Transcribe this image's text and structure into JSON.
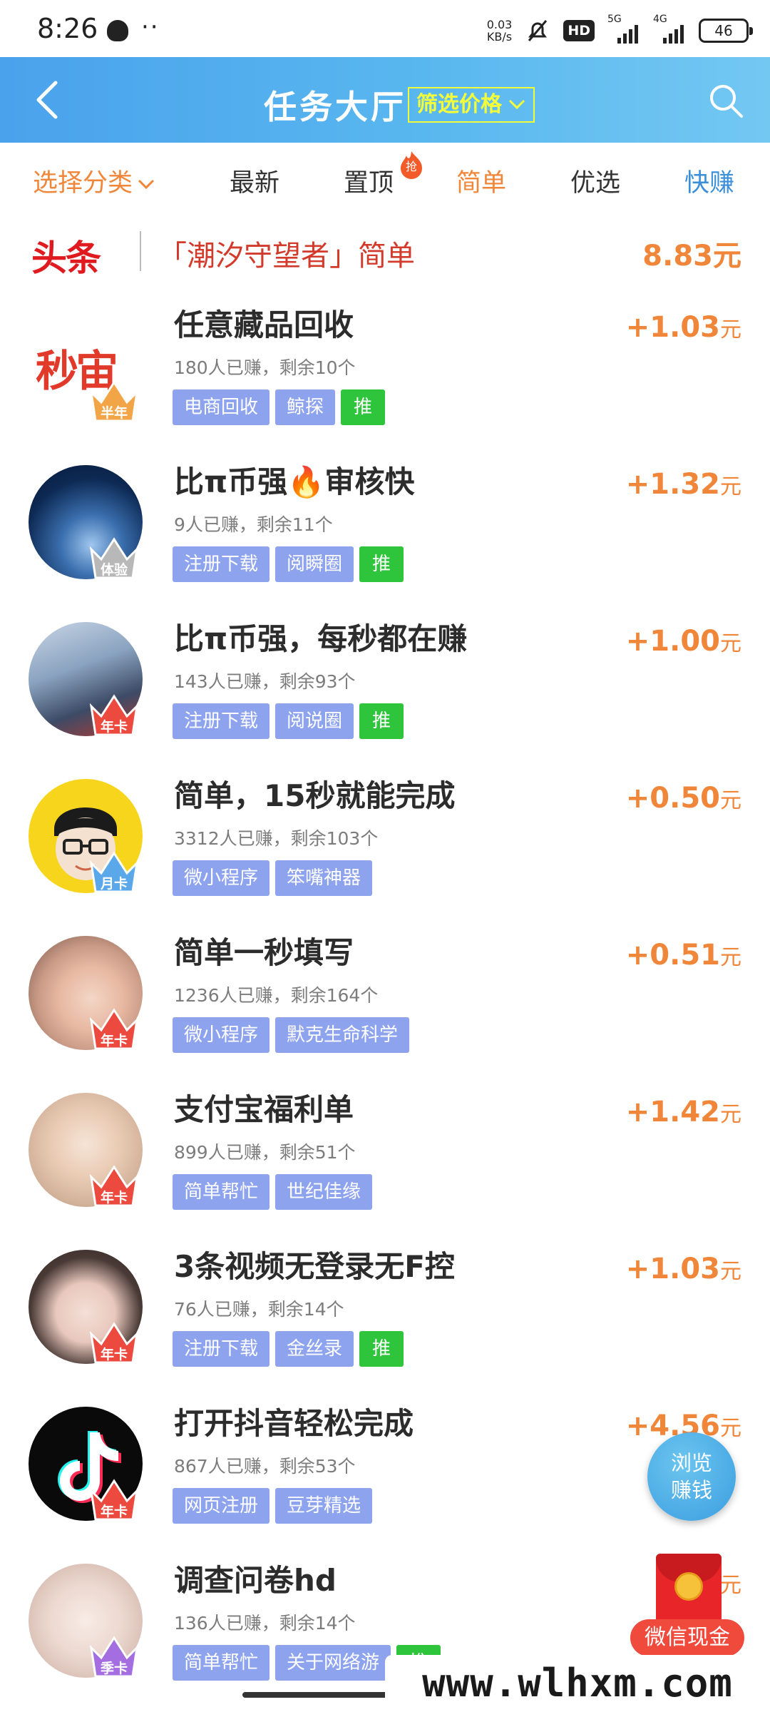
{
  "status_bar": {
    "time": "8:26",
    "dots": "··",
    "net_speed_value": "0.03",
    "net_speed_unit": "KB/s",
    "hd_label": "HD",
    "signal_1_label": "5G",
    "signal_2_label": "4G",
    "battery": "46"
  },
  "header": {
    "title": "任务大厅",
    "filter_label": "筛选价格"
  },
  "tabs": {
    "category_label": "选择分类",
    "items": [
      "最新",
      "置顶",
      "简单",
      "优选",
      "快赚"
    ],
    "hot_badge": "抢"
  },
  "headline": {
    "logo": "头条",
    "text": "「潮汐守望者」简单",
    "amount": "8.83元"
  },
  "tasks": [
    {
      "title": "任意藏品回收",
      "meta": "180人已赚，剩余10个",
      "reward": "+1.03",
      "unit": "元",
      "badge": "半年",
      "avatar_text": "秒宙",
      "tags": [
        "电商回收",
        "鲸探",
        "推"
      ]
    },
    {
      "title": "比π币强🔥审核快",
      "meta": "9人已赚，剩余11个",
      "reward": "+1.32",
      "unit": "元",
      "badge": "体验",
      "tags": [
        "注册下载",
        "阅瞬圈",
        "推"
      ]
    },
    {
      "title": "比π币强，每秒都在赚",
      "meta": "143人已赚，剩余93个",
      "reward": "+1.00",
      "unit": "元",
      "badge": "年卡",
      "tags": [
        "注册下载",
        "阅说圈",
        "推"
      ]
    },
    {
      "title": "简单，15秒就能完成",
      "meta": "3312人已赚，剩余103个",
      "reward": "+0.50",
      "unit": "元",
      "badge": "月卡",
      "tags": [
        "微小程序",
        "笨嘴神器"
      ]
    },
    {
      "title": "简单一秒填写",
      "meta": "1236人已赚，剩余164个",
      "reward": "+0.51",
      "unit": "元",
      "badge": "年卡",
      "tags": [
        "微小程序",
        "默克生命科学"
      ]
    },
    {
      "title": "支付宝福利单",
      "meta": "899人已赚，剩余51个",
      "reward": "+1.42",
      "unit": "元",
      "badge": "年卡",
      "tags": [
        "简单帮忙",
        "世纪佳缘"
      ]
    },
    {
      "title": "3条视频无登录无F控",
      "meta": "76人已赚，剩余14个",
      "reward": "+1.03",
      "unit": "元",
      "badge": "年卡",
      "tags": [
        "注册下载",
        "金丝录",
        "推"
      ]
    },
    {
      "title": "打开抖音轻松完成",
      "meta": "867人已赚，剩余53个",
      "reward": "+4.56",
      "unit": "元",
      "badge": "年卡",
      "tags": [
        "网页注册",
        "豆芽精选"
      ]
    },
    {
      "title": "调查问卷hd",
      "meta": "136人已赚，剩余14个",
      "reward": "+",
      "unit": "元",
      "badge": "季卡",
      "tags": [
        "简单帮忙",
        "关于网络游",
        "推"
      ]
    }
  ],
  "floating": {
    "browse_line1": "浏览",
    "browse_line2": "赚钱",
    "wechat_label": "微信现金"
  },
  "watermark": "www.wlhxm.com",
  "colors": {
    "header_start": "#4aa2ec",
    "header_end": "#73c8f2",
    "orange": "#f0863a",
    "tag_blue": "#8ea3ee",
    "tag_green": "#2ec43c",
    "headline_red": "#e01b20",
    "filter_yellow": "#f3ff3a"
  }
}
